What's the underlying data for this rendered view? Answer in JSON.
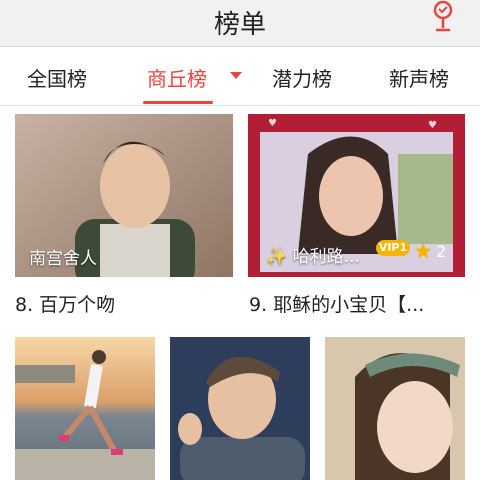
{
  "header": {
    "title": "榜单",
    "mic_icon": "microphone-icon"
  },
  "tabs": [
    {
      "label": "全国榜",
      "active": false
    },
    {
      "label": "商丘榜",
      "active": true
    },
    {
      "label": "潜力榜",
      "active": false
    },
    {
      "label": "新声榜",
      "active": false
    }
  ],
  "cards": [
    {
      "overlay_name": "南宫舍人",
      "caption": "8. 百万个吻"
    },
    {
      "overlay_name": "✨ 哈利路...",
      "badge": "VIP1",
      "stars": "2",
      "caption": "9. 耶稣的小宝贝【..."
    }
  ],
  "colors": {
    "accent": "#e8453f",
    "vip": "#f5b400"
  }
}
